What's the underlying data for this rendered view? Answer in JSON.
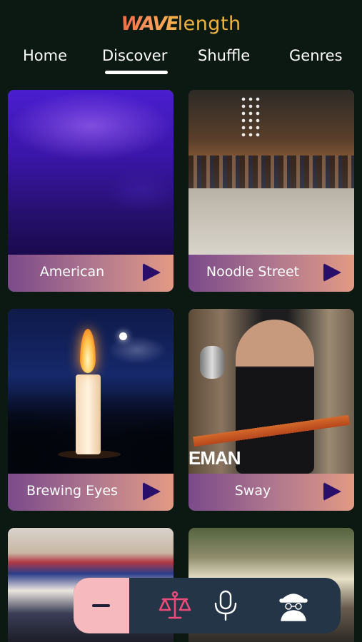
{
  "app": {
    "logo_wave": "WAVE",
    "logo_length": "length"
  },
  "tabs": [
    {
      "label": "Home"
    },
    {
      "label": "Discover",
      "active": true
    },
    {
      "label": "Shuffle"
    },
    {
      "label": "Genres"
    }
  ],
  "cards": [
    {
      "title": "American",
      "icon": "play-icon"
    },
    {
      "title": "Noodle Street",
      "icon": "play-icon"
    },
    {
      "title": "Brewing Eyes",
      "icon": "play-icon"
    },
    {
      "title": "Sway",
      "icon": "play-icon",
      "overlay_text": "EMAN"
    },
    {
      "title": "",
      "icon": "play-icon"
    },
    {
      "title": "",
      "icon": "play-icon"
    }
  ],
  "bottom_bar": {
    "items": [
      "minus-icon",
      "scale-icon",
      "microphone-icon",
      "spy-icon"
    ]
  },
  "colors": {
    "background": "#0c1913",
    "card_gradient_start": "#7b4a8a",
    "card_gradient_end": "#e39a84",
    "play_icon": "#2a0f6a",
    "bottom_bar": "#243547",
    "bottom_bar_accent": "#f6b9bd",
    "scale_icon": "#f04a78"
  }
}
